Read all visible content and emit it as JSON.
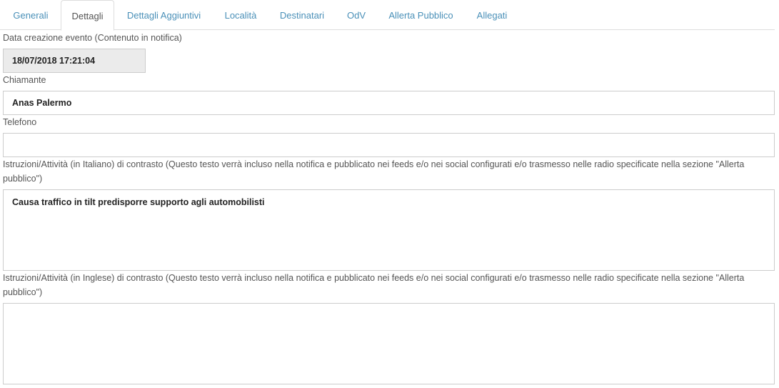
{
  "tabs": [
    {
      "label": "Generali"
    },
    {
      "label": "Dettagli"
    },
    {
      "label": "Dettagli Aggiuntivi"
    },
    {
      "label": "Località"
    },
    {
      "label": "Destinatari"
    },
    {
      "label": "OdV"
    },
    {
      "label": "Allerta Pubblico"
    },
    {
      "label": "Allegati"
    }
  ],
  "active_tab": "Dettagli",
  "form": {
    "data_creazione": {
      "label": "Data creazione evento (Contenuto in notifica)",
      "value": "18/07/2018 17:21:04"
    },
    "chiamante": {
      "label": "Chiamante",
      "value": "Anas Palermo"
    },
    "telefono": {
      "label": "Telefono",
      "value": ""
    },
    "istruzioni_it": {
      "label": "Istruzioni/Attività (in Italiano) di contrasto (Questo testo verrà incluso nella notifica e pubblicato nei feeds e/o nei social configurati e/o trasmesso nelle radio specificate nella sezione \"Allerta pubblico\")",
      "value": "Causa traffico in tilt predisporre supporto agli automobilisti"
    },
    "istruzioni_en": {
      "label": "Istruzioni/Attività (in Inglese) di contrasto (Questo testo verrà incluso nella notifica e pubblicato nei feeds e/o nei social configurati e/o trasmesso nelle radio specificate nella sezione \"Allerta pubblico\")",
      "value": ""
    }
  },
  "colors": {
    "tab_link": "#4a90b8",
    "readonly_bg": "#ebebeb",
    "border": "#cccccc"
  }
}
